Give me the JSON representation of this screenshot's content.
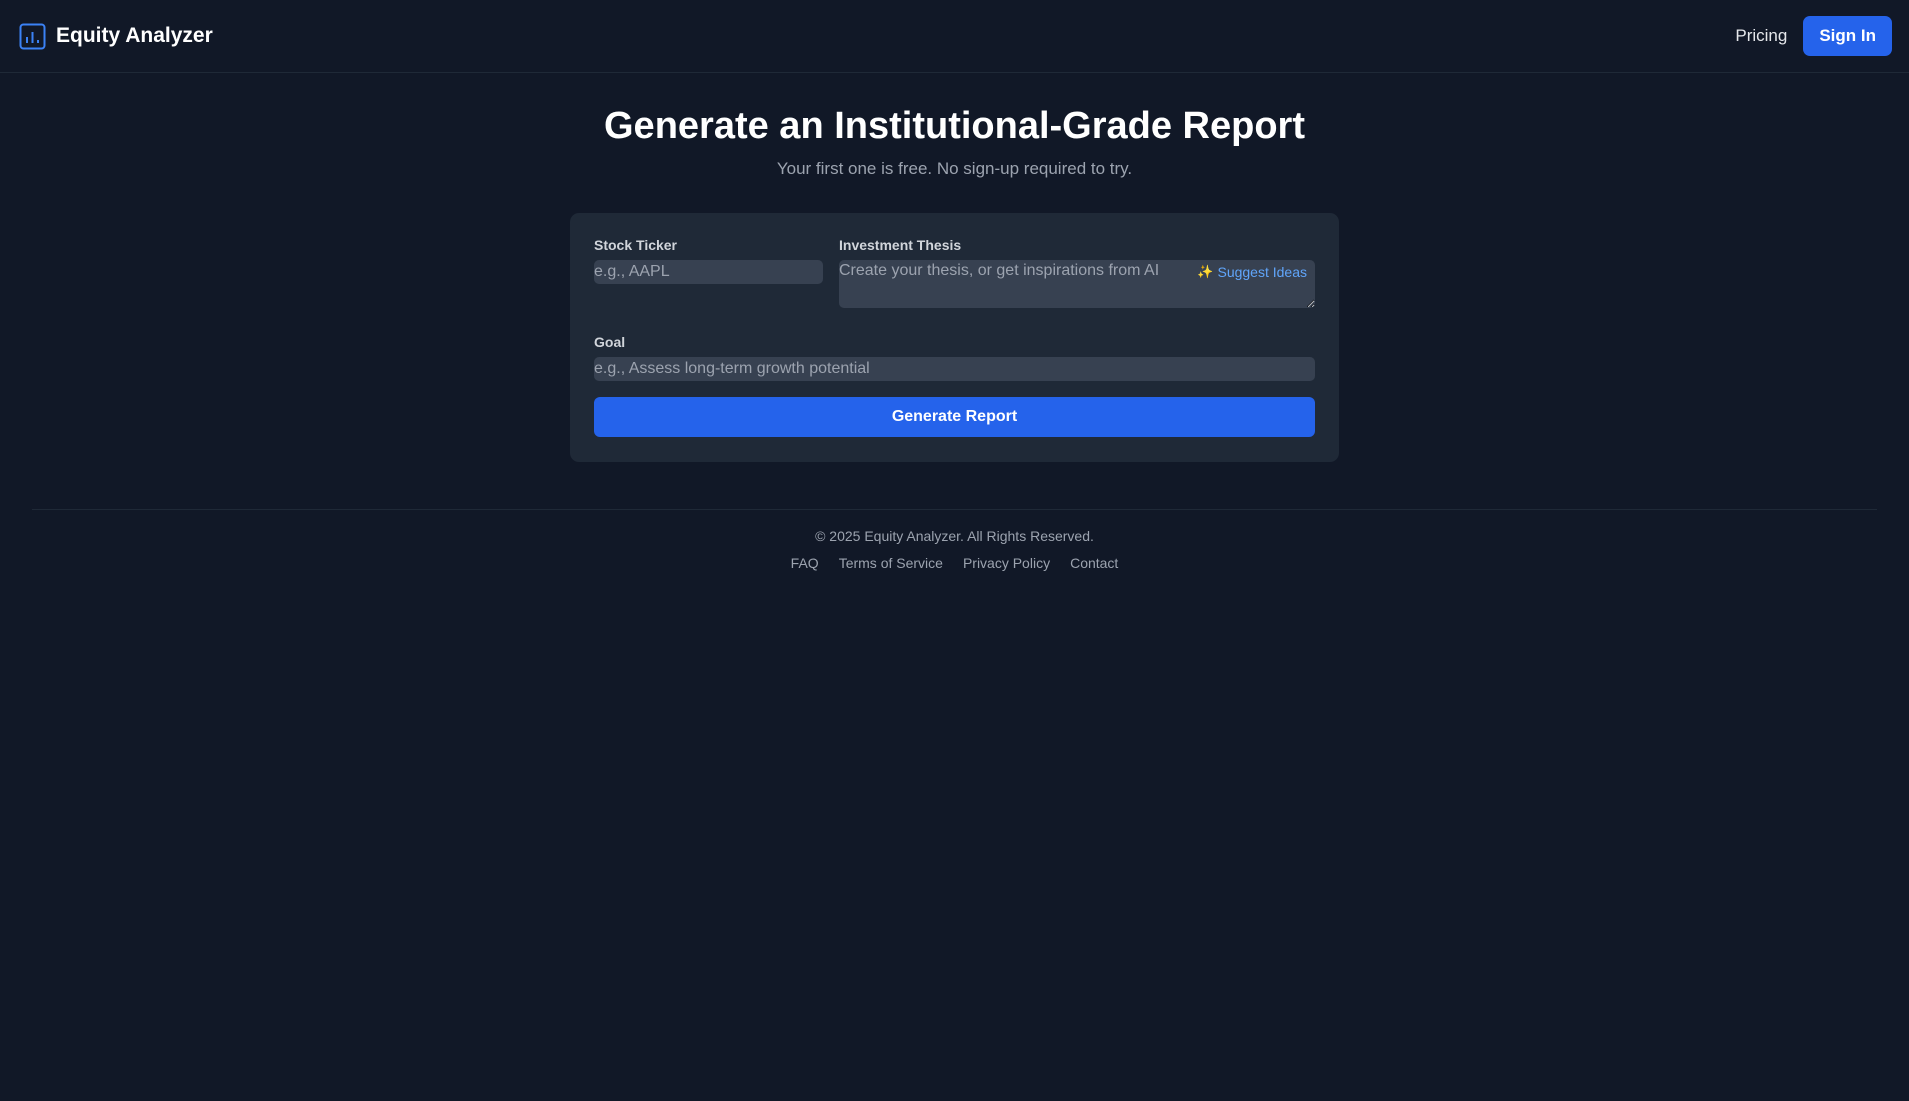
{
  "header": {
    "brand": "Equity Analyzer",
    "brand_icon": "bar-chart-icon",
    "nav_pricing": "Pricing",
    "signin_label": "Sign In"
  },
  "hero": {
    "title": "Generate an Institutional-Grade Report",
    "subtitle": "Your first one is free. No sign-up required to try."
  },
  "form": {
    "ticker_label": "Stock Ticker",
    "ticker_placeholder": "e.g., AAPL",
    "thesis_label": "Investment Thesis",
    "thesis_placeholder": "Create your thesis, or get inspirations from AI",
    "suggest_label": "Suggest Ideas",
    "suggest_icon": "sparkle-icon",
    "goal_label": "Goal",
    "goal_placeholder": "e.g., Assess long-term growth potential",
    "generate_label": "Generate Report"
  },
  "footer": {
    "copyright": "© 2025 Equity Analyzer. All Rights Reserved.",
    "links": [
      "FAQ",
      "Terms of Service",
      "Privacy Policy",
      "Contact"
    ]
  },
  "colors": {
    "background": "#111827",
    "card": "#1f2937",
    "accent": "#2563eb",
    "link": "#60a5fa"
  }
}
